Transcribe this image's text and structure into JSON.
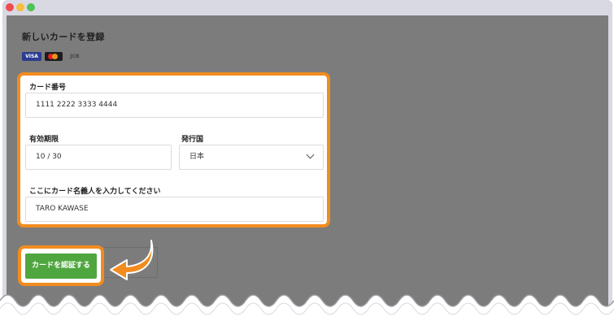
{
  "form": {
    "title": "新しいカードを登録",
    "card_brands": [
      "VISA",
      "Mastercard",
      "JCB"
    ],
    "card_number_label": "カード番号",
    "card_number_value": "1111 2222 3333 4444",
    "expiry_label": "有効期限",
    "expiry_value": "10 / 30",
    "country_label": "発行国",
    "country_value": "日本",
    "name_label": "ここにカード名義人を入力してください",
    "name_value": "TARO KAWASE",
    "submit_label": "カードを認証する"
  },
  "colors": {
    "highlight": "#f28c1f",
    "submit": "#4fa63f",
    "overlay": "#7c7c7c"
  },
  "icons": [
    "chevron-down-icon",
    "arrow-icon"
  ]
}
